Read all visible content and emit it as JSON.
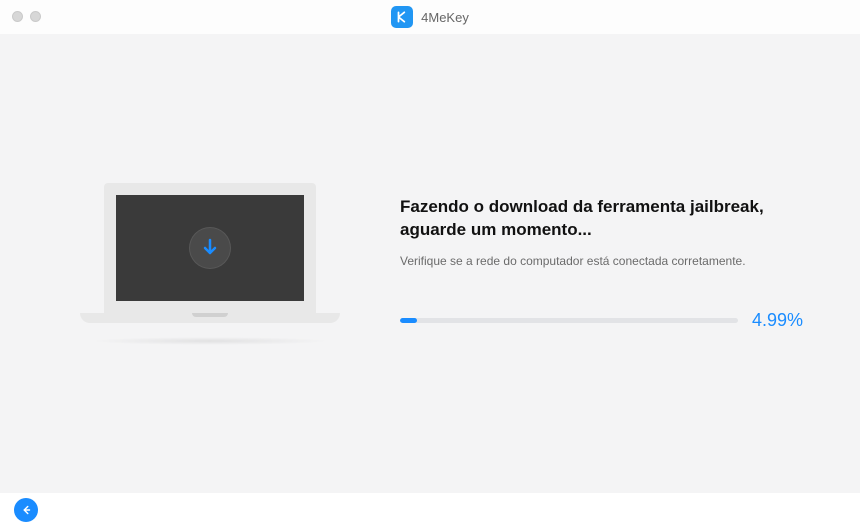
{
  "app": {
    "name": "4MeKey"
  },
  "status": {
    "title": "Fazendo o download da ferramenta jailbreak, aguarde um momento...",
    "subtitle": "Verifique se a rede do computador está conectada corretamente."
  },
  "progress": {
    "percent_value": 4.99,
    "percent_text": "4.99%"
  },
  "icons": {
    "app_logo": "letter-k-logo",
    "download": "download-arrow-icon",
    "back": "arrow-left-icon"
  },
  "colors": {
    "accent": "#1a8cff",
    "panel_bg": "#f4f4f5",
    "screen_dark": "#3a3a3a"
  }
}
